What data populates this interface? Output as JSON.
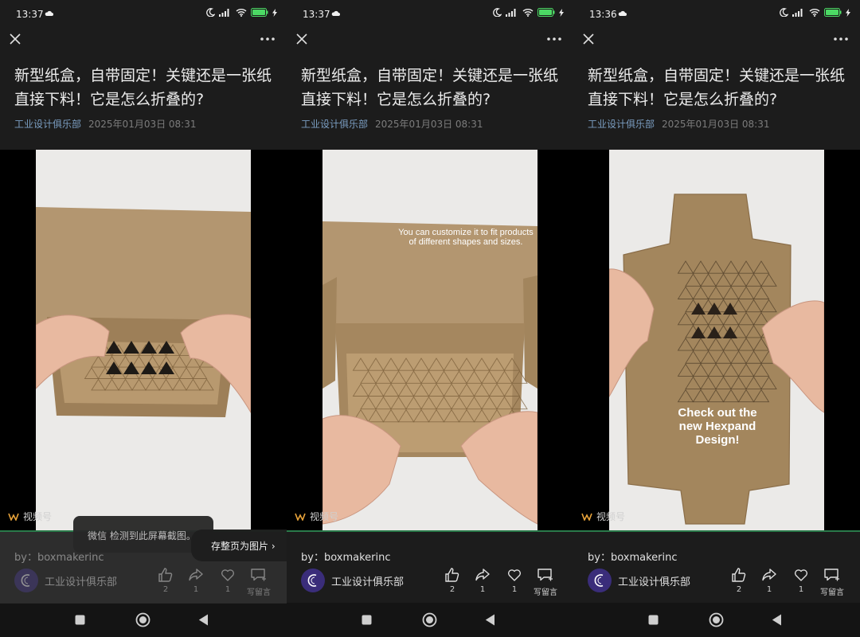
{
  "article": {
    "title": "新型纸盒，自带固定！关键还是一张纸直接下料！它是怎么折叠的?",
    "author": "工业设计俱乐部",
    "date": "2025年01月03日 08:31",
    "by_prefix": "by：",
    "by_name": "boxmakerinc",
    "account_name": "工业设计俱乐部",
    "avatar_letter": "C",
    "channel_label": "视频号"
  },
  "actions": {
    "like_count": "2",
    "share_count": "1",
    "love_count": "1",
    "comment_label": "写留言"
  },
  "panels": [
    {
      "time": "13:37",
      "caption": "",
      "toast": "微信 检测到此屏幕截图。",
      "save_hint": "存整页为图片 ›"
    },
    {
      "time": "13:37",
      "caption": "You can customize it to fit products of different shapes and sizes."
    },
    {
      "time": "13:36",
      "caption": "Check out the new Hexpand Design!"
    }
  ],
  "colors": {
    "background": "#1c1c1c",
    "video_bg": "#000000",
    "author_link": "#7b9ec2",
    "battery": "#4cd964",
    "avatar": "#3a2d7a",
    "cardboard": "#a88a62"
  },
  "icons": [
    "cloud-icon",
    "moon-icon",
    "signal-icon",
    "wifi-icon",
    "battery-icon",
    "close-icon",
    "more-icon",
    "channel-icon",
    "thumbs-up-icon",
    "share-icon",
    "heart-icon",
    "comment-icon",
    "square-icon",
    "circle-icon",
    "triangle-icon"
  ]
}
